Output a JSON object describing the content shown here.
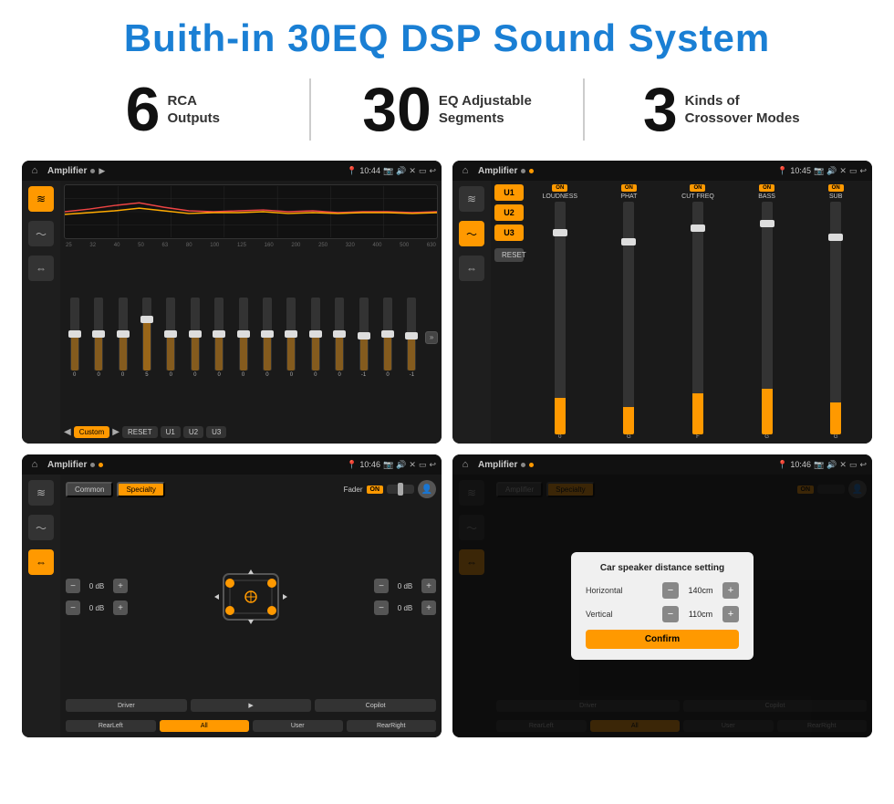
{
  "page": {
    "title": "Buith-in 30EQ DSP Sound System"
  },
  "stats": [
    {
      "number": "6",
      "line1": "RCA",
      "line2": "Outputs"
    },
    {
      "number": "30",
      "line1": "EQ Adjustable",
      "line2": "Segments"
    },
    {
      "number": "3",
      "line1": "Kinds of",
      "line2": "Crossover Modes"
    }
  ],
  "screens": [
    {
      "id": "eq-screen",
      "time": "10:44",
      "title": "Amplifier",
      "freqs": [
        "25",
        "32",
        "40",
        "50",
        "63",
        "80",
        "100",
        "125",
        "160",
        "200",
        "250",
        "320",
        "400",
        "500",
        "630"
      ],
      "values": [
        "0",
        "0",
        "0",
        "5",
        "0",
        "0",
        "0",
        "0",
        "0",
        "0",
        "0",
        "0",
        "-1",
        "0",
        "-1"
      ],
      "bottom_btns": [
        "Custom",
        "RESET",
        "U1",
        "U2",
        "U3"
      ]
    },
    {
      "id": "crossover-screen",
      "time": "10:45",
      "title": "Amplifier",
      "u_buttons": [
        "U1",
        "U2",
        "U3"
      ],
      "columns": [
        "LOUDNESS",
        "PHAT",
        "CUT FREQ",
        "BASS",
        "SUB"
      ],
      "reset_label": "RESET"
    },
    {
      "id": "fader-screen",
      "time": "10:46",
      "title": "Amplifier",
      "tabs": [
        "Common",
        "Specialty"
      ],
      "fader_label": "Fader",
      "fader_on": "ON",
      "db_values": [
        "0 dB",
        "0 dB",
        "0 dB",
        "0 dB"
      ],
      "bottom_btns": [
        "Driver",
        "",
        "Copilot",
        "RearLeft",
        "All",
        "User",
        "RearRight"
      ]
    },
    {
      "id": "dialog-screen",
      "time": "10:46",
      "title": "Amplifier",
      "dialog": {
        "title": "Car speaker distance setting",
        "horizontal_label": "Horizontal",
        "horizontal_value": "140cm",
        "vertical_label": "Vertical",
        "vertical_value": "110cm",
        "confirm_label": "Confirm"
      },
      "bottom_btns": [
        "Driver",
        "Copilot",
        "RearLeft",
        "All",
        "User",
        "RearRight"
      ]
    }
  ],
  "icons": {
    "home": "⌂",
    "back": "↩",
    "volume": "♪",
    "location": "📍",
    "camera": "📷",
    "search": "🔍",
    "person": "👤",
    "play": "▶",
    "pause": "⏸",
    "prev": "◀",
    "next": "▶",
    "eq_icon": "≋",
    "wave_icon": "〜",
    "arrows_icon": "⇔",
    "expand": "»"
  }
}
